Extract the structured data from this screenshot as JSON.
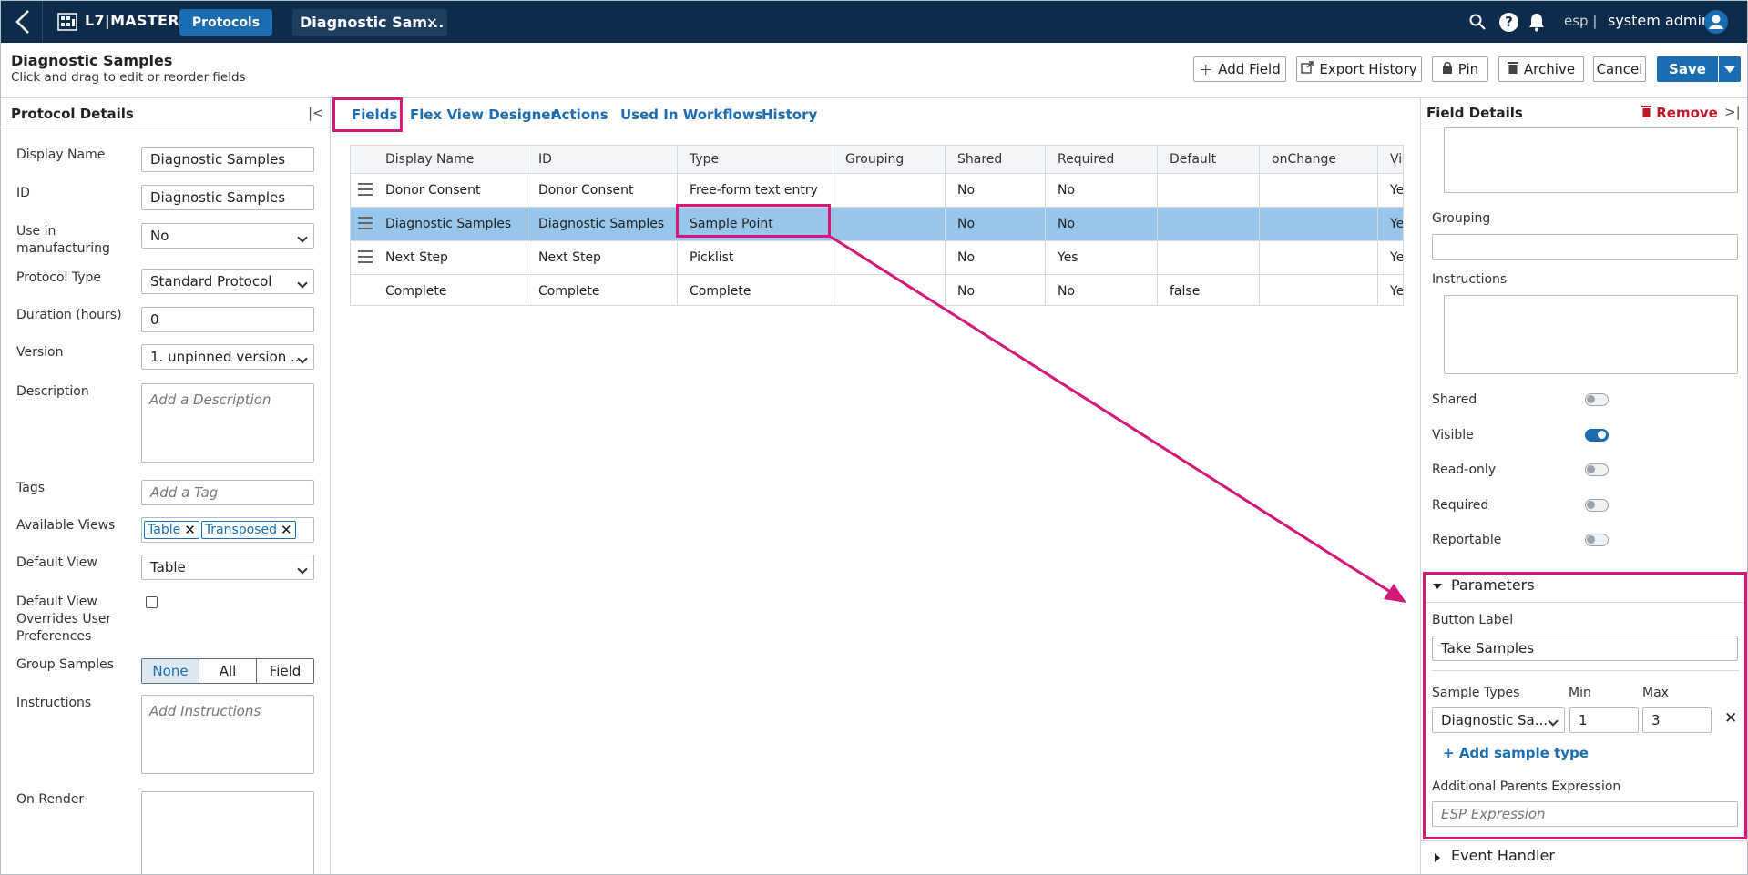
{
  "topbar": {
    "brand": "L7|MASTER",
    "nav_protocols": "Protocols",
    "open_tab": "Diagnostic Sam...",
    "open_tab_close": "×",
    "help": "?",
    "org": "esp |",
    "user": "system admin"
  },
  "header": {
    "title": "Diagnostic Samples",
    "subtitle": "Click and drag to edit or reorder fields",
    "add_field": "Add Field",
    "export_history": "Export History",
    "pin": "Pin",
    "archive": "Archive",
    "cancel": "Cancel",
    "save": "Save"
  },
  "left_panel": {
    "title": "Protocol Details",
    "collapse": "|<",
    "display_name_label": "Display Name",
    "display_name": "Diagnostic Samples",
    "id_label": "ID",
    "id": "Diagnostic Samples",
    "use_in_mfg_label": "Use in manufacturing",
    "use_in_mfg": "No",
    "protocol_type_label": "Protocol Type",
    "protocol_type": "Standard Protocol",
    "duration_label": "Duration (hours)",
    "duration": "0",
    "version_label": "Version",
    "version": "1. unpinned version ...",
    "description_label": "Description",
    "description_placeholder": "Add a Description",
    "tags_label": "Tags",
    "tags_placeholder": "Add a Tag",
    "available_views_label": "Available Views",
    "available_views": [
      "Table",
      "Transposed"
    ],
    "chip_remove": "✕",
    "default_view_label": "Default View",
    "default_view": "Table",
    "default_view_override_label": "Default View Overrides User Preferences",
    "group_samples_label": "Group Samples",
    "group_samples_options": [
      "None",
      "All",
      "Field"
    ],
    "instructions_label": "Instructions",
    "instructions_placeholder": "Add Instructions",
    "on_render_label": "On Render"
  },
  "center": {
    "tabs": [
      "Fields",
      "Flex View Designer",
      "Actions",
      "Used In Workflows",
      "History"
    ],
    "columns": [
      "Display Name",
      "ID",
      "Type",
      "Grouping",
      "Shared",
      "Required",
      "Default",
      "onChange",
      "Vi"
    ],
    "rows": [
      [
        "Donor Consent",
        "Donor Consent",
        "Free-form text entry",
        "",
        "No",
        "No",
        "",
        "",
        "Ye"
      ],
      [
        "Diagnostic Samples",
        "Diagnostic Samples",
        "Sample Point",
        "",
        "No",
        "No",
        "",
        "",
        "Ye"
      ],
      [
        "Next Step",
        "Next Step",
        "Picklist",
        "",
        "No",
        "Yes",
        "",
        "",
        "Ye"
      ],
      [
        "Complete",
        "Complete",
        "Complete",
        "",
        "No",
        "No",
        "false",
        "",
        "Ye"
      ]
    ]
  },
  "right_panel": {
    "title": "Field Details",
    "remove": "Remove",
    "collapse": ">|",
    "grouping_label": "Grouping",
    "instructions_label": "Instructions",
    "shared_label": "Shared",
    "visible_label": "Visible",
    "readonly_label": "Read-only",
    "required_label": "Required",
    "reportable_label": "Reportable",
    "toggles": {
      "shared": false,
      "visible": true,
      "readonly": false,
      "required": false,
      "reportable": false
    },
    "parameters_title": "Parameters",
    "button_label_label": "Button Label",
    "button_label": "Take Samples",
    "sample_types_label": "Sample Types",
    "min_label": "Min",
    "max_label": "Max",
    "sample_type": "Diagnostic Sa...",
    "min": "1",
    "max": "3",
    "delete": "✕",
    "add_sample_type": "Add sample type",
    "add_plus": "+",
    "additional_parents_label": "Additional Parents Expression",
    "additional_parents_placeholder": "ESP Expression",
    "event_handler_title": "Event Handler"
  },
  "colors": {
    "topbar": "#0d2b4a",
    "accent": "#1b6cb0",
    "highlight": "#d4187a",
    "selected_row": "#97c6ea",
    "danger": "#c0182b"
  }
}
